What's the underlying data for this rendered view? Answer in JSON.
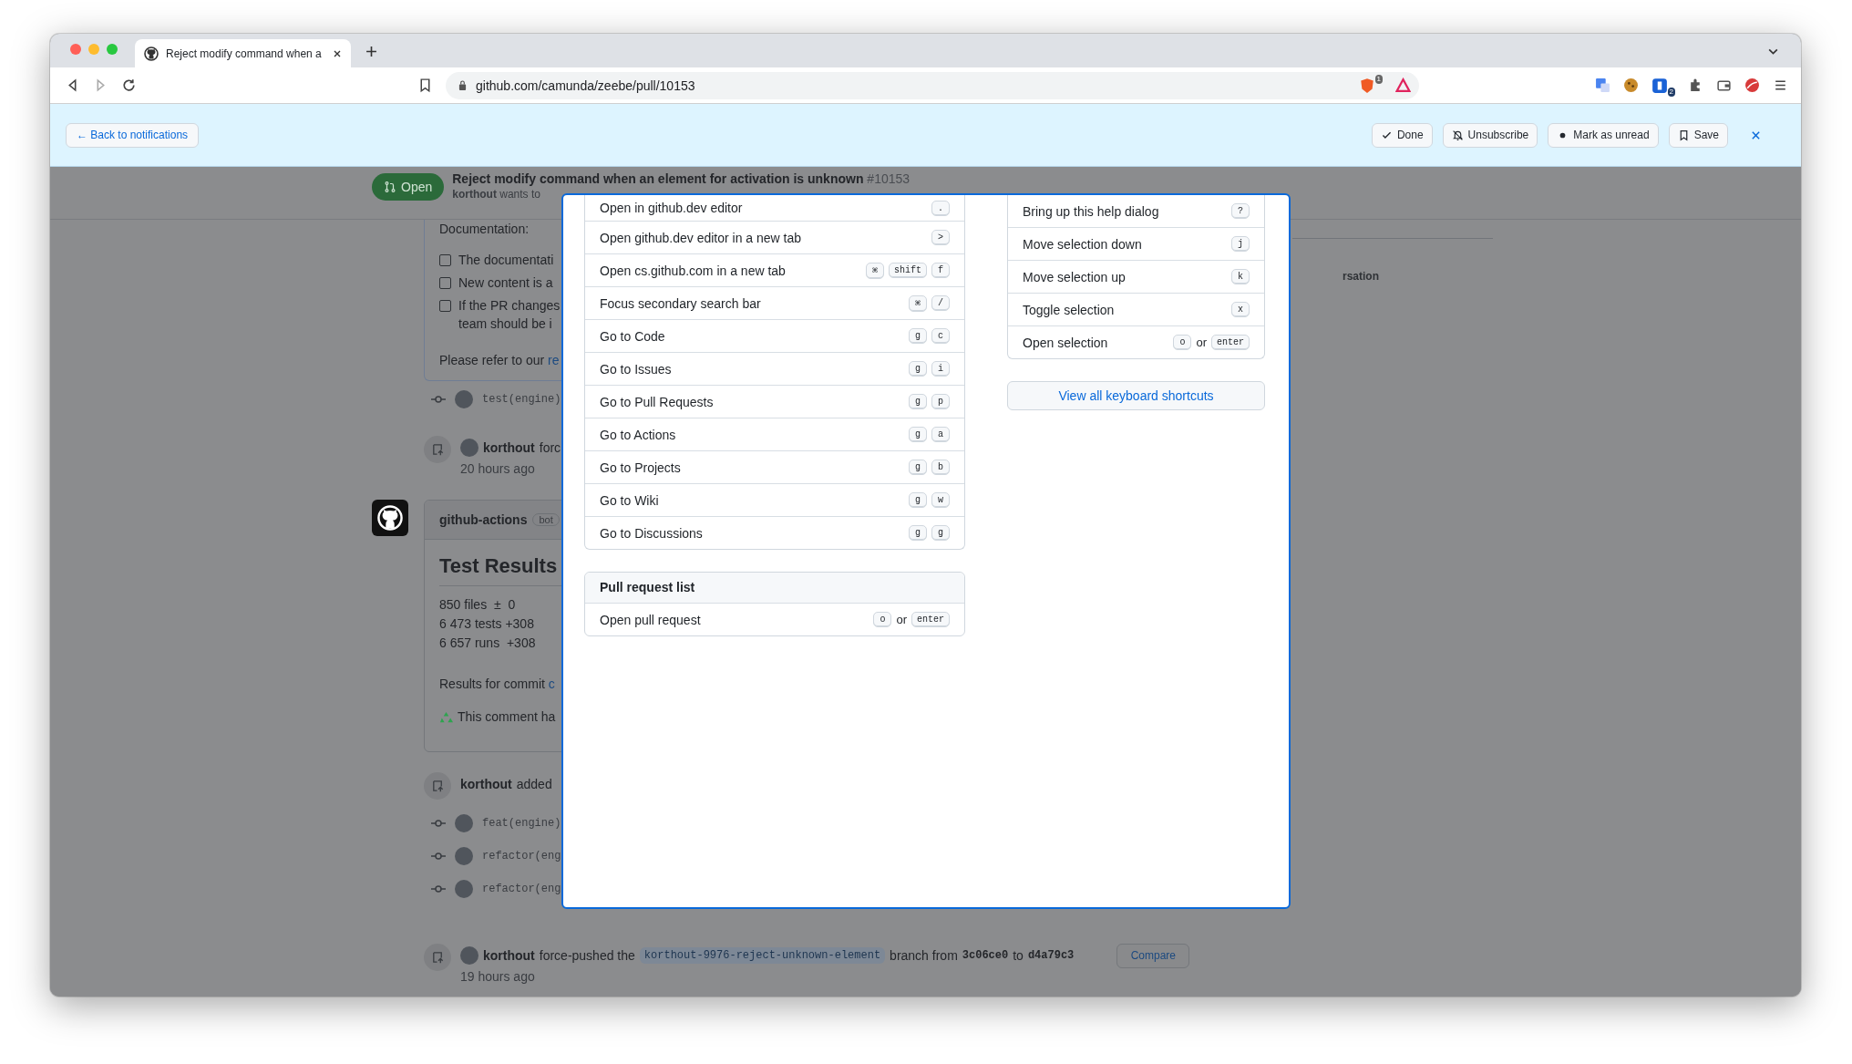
{
  "browser": {
    "tab_title": "Reject modify command when a",
    "url": "github.com/camunda/zeebe/pull/10153",
    "brave_count": "1",
    "ext_count": "2"
  },
  "notification_bar": {
    "back": "← Back to notifications",
    "actions": [
      {
        "label": "Done",
        "kind": "done"
      },
      {
        "label": "Unsubscribe",
        "kind": "unsubscribe"
      },
      {
        "label": "Mark as unread",
        "kind": "unread"
      },
      {
        "label": "Save",
        "kind": "save"
      }
    ]
  },
  "pull_request": {
    "state": "Open",
    "title": "Reject modify command when an element for activation is unknown",
    "number": "#10153",
    "author": "korthout",
    "subtitle": "wants to"
  },
  "side_tab": "rsation",
  "description": {
    "heading": "Documentation:",
    "checklist": [
      {
        "text": "The documentati",
        "checked": false
      },
      {
        "text": "New content is a",
        "checked": false
      },
      {
        "text": "If the PR changes",
        "continuation": "team should be i",
        "checked": false
      }
    ],
    "note": "Please refer to our",
    "note_link": "re"
  },
  "timeline": [
    {
      "kind": "commit",
      "message": "test(engine)"
    },
    {
      "kind": "push",
      "author": "korthout",
      "action": "forc",
      "time": "20 hours ago"
    },
    {
      "kind": "comment",
      "author": "github-actions",
      "badge": "bot",
      "title": "Test Results",
      "stats": [
        "850 files  ±  0",
        "6 473 tests +308",
        "6 657 runs  +308"
      ],
      "commit_text": "Results for commit",
      "commit_link": "c",
      "footer": "This comment ha"
    },
    {
      "kind": "push",
      "author": "korthout",
      "action": "added"
    },
    {
      "kind": "commit",
      "message": "feat(engine)"
    },
    {
      "kind": "commit",
      "message": "refactor(eng"
    },
    {
      "kind": "commit",
      "message": "refactor(eng"
    },
    {
      "kind": "push",
      "author": "korthout",
      "action": "force-pushed the",
      "branch": "korthout-9976-reject-unknown-element",
      "mid": "branch from",
      "from": "3c06ce0",
      "to_word": "to",
      "to": "d4a79c3",
      "button": "Compare",
      "time": "19 hours ago"
    }
  ],
  "shortcuts_dialog": {
    "left_list": [
      {
        "label": "Open in github.dev editor",
        "keys": [
          "."
        ]
      },
      {
        "label": "Open github.dev editor in a new tab",
        "keys": [
          ">"
        ]
      },
      {
        "label": "Open cs.github.com in a new tab",
        "keys": [
          "⌘",
          "shift",
          "f"
        ]
      },
      {
        "label": "Focus secondary search bar",
        "keys": [
          "⌘",
          "/"
        ]
      },
      {
        "label": "Go to Code",
        "keys": [
          "g",
          "c"
        ]
      },
      {
        "label": "Go to Issues",
        "keys": [
          "g",
          "i"
        ]
      },
      {
        "label": "Go to Pull Requests",
        "keys": [
          "g",
          "p"
        ]
      },
      {
        "label": "Go to Actions",
        "keys": [
          "g",
          "a"
        ]
      },
      {
        "label": "Go to Projects",
        "keys": [
          "g",
          "b"
        ]
      },
      {
        "label": "Go to Wiki",
        "keys": [
          "g",
          "w"
        ]
      },
      {
        "label": "Go to Discussions",
        "keys": [
          "g",
          "g"
        ]
      }
    ],
    "sections": [
      {
        "title": "Pull request list",
        "items": [
          {
            "label": "Open pull request",
            "keys": [
              "o",
              "enter"
            ],
            "joiner": "or"
          }
        ]
      }
    ],
    "right_list": [
      {
        "label": "Bring up this help dialog",
        "keys": [
          "?"
        ]
      },
      {
        "label": "Move selection down",
        "keys": [
          "j"
        ]
      },
      {
        "label": "Move selection up",
        "keys": [
          "k"
        ]
      },
      {
        "label": "Toggle selection",
        "keys": [
          "x"
        ]
      },
      {
        "label": "Open selection",
        "keys": [
          "o",
          "enter"
        ],
        "joiner": "or"
      }
    ],
    "view_all": "View all keyboard shortcuts"
  }
}
